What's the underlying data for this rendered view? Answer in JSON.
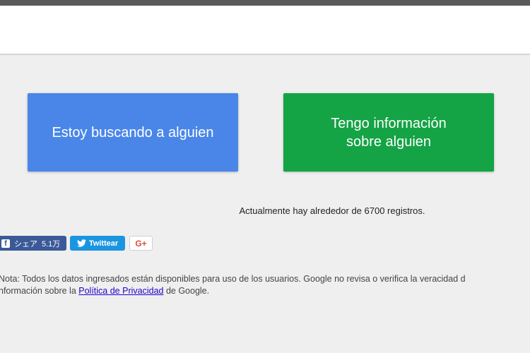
{
  "buttons": {
    "search": "Estoy buscando a alguien",
    "info": "Tengo información sobre alguien"
  },
  "records_text": "Actualmente hay alrededor de 6700 registros.",
  "share": {
    "facebook_label": "シェア",
    "facebook_count": "5.1万",
    "twitter_label": "Twittear",
    "google_label": "G+"
  },
  "note": {
    "line1": "Nota: Todos los datos ingresados están disponibles para uso de los usuarios. Google no revisa o verifica la veracidad d",
    "line2_prefix": "nformación sobre la ",
    "privacy_link": "Política de Privacidad",
    "line2_suffix": " de Google."
  },
  "colors": {
    "search_button": "#4a86e8",
    "info_button": "#14a345",
    "facebook": "#3b5998",
    "twitter": "#1b95e0"
  },
  "icons": [
    "facebook-icon",
    "twitter-icon"
  ]
}
